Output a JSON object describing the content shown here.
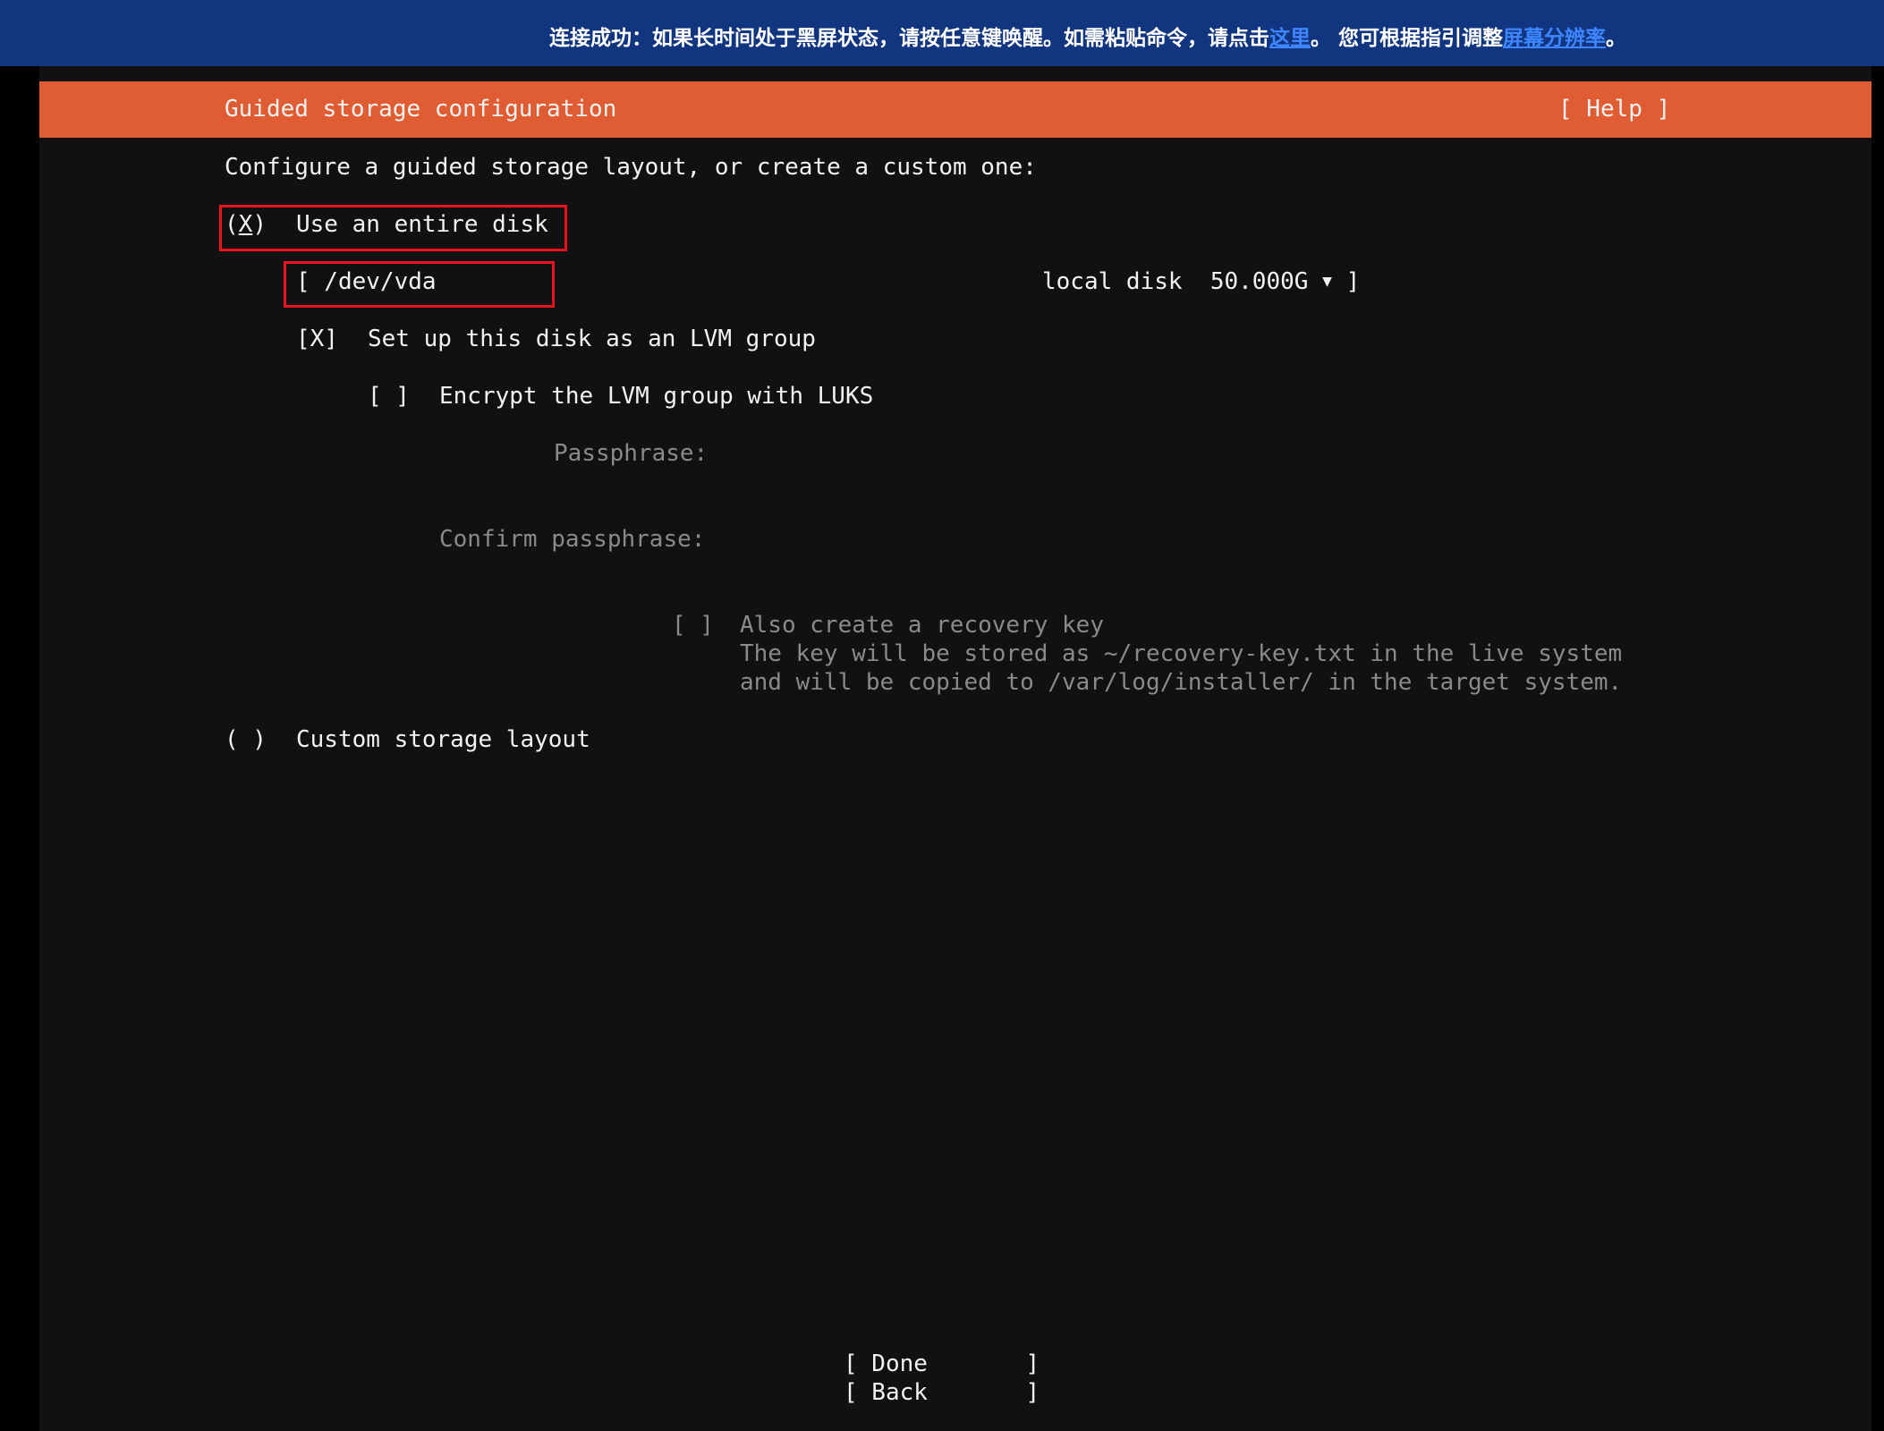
{
  "banner": {
    "text_before": "连接成功：如果长时间处于黑屏状态，请按任意键唤醒。如需粘贴命令，请点击",
    "link_here": "这里",
    "text_middle": "。 您可根据指引调整",
    "link_resolution": "屏幕分辨率",
    "text_end": "。"
  },
  "header": {
    "title": "Guided storage configuration",
    "help": "[ Help ]"
  },
  "intro": "Configure a guided storage layout, or create a custom one:",
  "entire_disk": {
    "open": "(",
    "mark": "X",
    "close": ")",
    "label": "Use an entire disk"
  },
  "disk_select": {
    "device": "[ /dev/vda",
    "info": "local disk  50.000G",
    "arrow": "▼",
    "close": "]"
  },
  "lvm": {
    "checkbox": "[X]",
    "label": "Set up this disk as an LVM group"
  },
  "encrypt": {
    "checkbox": "[ ]",
    "label": "Encrypt the LVM group with LUKS"
  },
  "passphrase_label": "Passphrase:",
  "confirm_label": "Confirm passphrase:",
  "recovery": {
    "checkbox": "[ ]",
    "label": "Also create a recovery key",
    "line1": "The key will be stored as ~/recovery-key.txt in the live system",
    "line2": "and will be copied to /var/log/installer/ in the target system."
  },
  "custom": {
    "radio": "( )",
    "label": "Custom storage layout"
  },
  "buttons": {
    "done": "[ Done       ]",
    "back": "[ Back       ]"
  },
  "colors": {
    "banner_bg": "#11357e",
    "header_bg": "#e05d33",
    "screen_bg": "#111111",
    "highlight": "#e8141e"
  }
}
